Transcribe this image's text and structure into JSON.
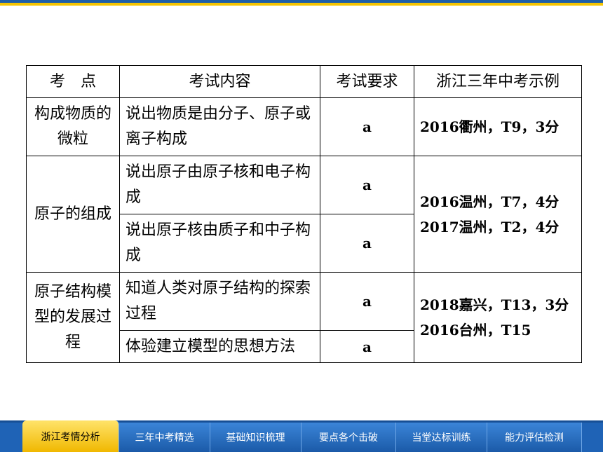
{
  "table": {
    "headers": [
      "考　点",
      "考试内容",
      "考试要求",
      "浙江三年中考示例"
    ],
    "groups": [
      {
        "topic": "构成物质的微粒",
        "items": [
          {
            "content": "说出物质是由分子、原子或离子构成",
            "level": "a"
          }
        ],
        "examples": [
          "2016衢州，T9，3分"
        ]
      },
      {
        "topic": "原子的组成",
        "items": [
          {
            "content": "说出原子由原子核和电子构成",
            "level": "a"
          },
          {
            "content": "说出原子核由质子和中子构成",
            "level": "a"
          }
        ],
        "examples": [
          "2016温州，T7，4分",
          "2017温州，T2，4分"
        ]
      },
      {
        "topic": "原子结构模型的发展过程",
        "items": [
          {
            "content": "知道人类对原子结构的探索过程",
            "level": "a"
          },
          {
            "content": "体验建立模型的思想方法",
            "level": "a"
          }
        ],
        "examples": [
          "2018嘉兴，T13，3分",
          "2016台州，T15"
        ]
      }
    ]
  },
  "nav": {
    "tabs": [
      {
        "label": "浙江考情分析",
        "active": true
      },
      {
        "label": "三年中考精选",
        "active": false
      },
      {
        "label": "基础知识梳理",
        "active": false
      },
      {
        "label": "要点各个击破",
        "active": false
      },
      {
        "label": "当堂达标训练",
        "active": false
      },
      {
        "label": "能力评估检测",
        "active": false
      }
    ]
  },
  "colors": {
    "nav_blue": "#1f63b6",
    "active_tab": "#f5c400",
    "top_line_blue": "#1f5fa8",
    "top_line_yellow": "#f5c400"
  }
}
